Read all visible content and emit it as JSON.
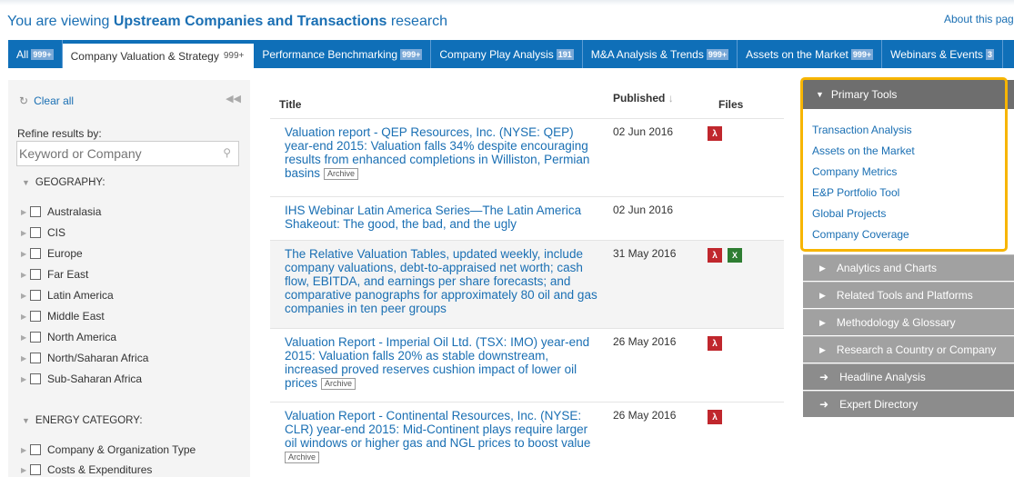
{
  "header": {
    "viewing_prefix": "You are viewing",
    "viewing_bold": "Upstream Companies and Transactions",
    "viewing_suffix": "research",
    "about_link": "About this page"
  },
  "tabs": [
    {
      "label": "All",
      "badge": "999+"
    },
    {
      "label": "Company Valuation & Strategy",
      "badge": "999+"
    },
    {
      "label": "Performance Benchmarking",
      "badge": "999+"
    },
    {
      "label": "Company Play Analysis",
      "badge": "191"
    },
    {
      "label": "M&A Analysis & Trends",
      "badge": "999+"
    },
    {
      "label": "Assets on the Market",
      "badge": "999+"
    },
    {
      "label": "Webinars & Events",
      "badge": "3"
    }
  ],
  "left_panel": {
    "clear_all": "Clear all",
    "refine_label": "Refine results by:",
    "search_placeholder": "Keyword or Company",
    "geography_heading": "GEOGRAPHY:",
    "geography": [
      "Australasia",
      "CIS",
      "Europe",
      "Far East",
      "Latin America",
      "Middle East",
      "North America",
      "North/Saharan Africa",
      "Sub-Saharan Africa"
    ],
    "energy_heading": "ENERGY CATEGORY:",
    "energy": [
      "Company & Organization Type",
      "Costs & Expenditures"
    ]
  },
  "results": {
    "col_title": "Title",
    "col_published": "Published",
    "col_files": "Files",
    "archive_label": "Archive",
    "rows": [
      {
        "title": "Valuation report - QEP Resources, Inc. (NYSE: QEP) year-end 2015: Valuation falls 34% despite encouraging results from enhanced completions in Williston, Permian basins",
        "date": "02 Jun 2016"
      },
      {
        "title": "IHS Webinar Latin America Series—The Latin America Shakeout: The good, the bad, and the ugly",
        "date": "02 Jun 2016"
      },
      {
        "title": "The Relative Valuation Tables, updated weekly, include company valuations, debt-to-appraised net worth; cash flow, EBITDA, and earnings per share forecasts; and comparative panographs for approximately 80 oil and gas companies in ten peer groups",
        "date": "31 May 2016"
      },
      {
        "title": "Valuation Report - Imperial Oil Ltd. (TSX: IMO) year-end 2015: Valuation falls 20% as stable downstream, increased proved reserves cushion impact of lower oil prices",
        "date": "26 May 2016"
      },
      {
        "title": "Valuation Report - Continental Resources, Inc. (NYSE: CLR) year-end 2015: Mid-Continent plays require larger oil windows or higher gas and NGL prices to boost value",
        "date": "26 May 2016"
      }
    ]
  },
  "right_panel": {
    "primary_heading": "Primary Tools",
    "primary_tools": [
      "Transaction Analysis",
      "Assets on the Market",
      "Company Metrics",
      "E&P Portfolio Tool",
      "Global Projects",
      "Company Coverage"
    ],
    "sections": [
      "Analytics and Charts",
      "Related Tools and Platforms",
      "Methodology & Glossary",
      "Research a Country or Company"
    ],
    "links": [
      "Headline Analysis",
      "Expert Directory"
    ]
  },
  "colors": {
    "tab_bar": "#0f6fb8",
    "link": "#1a6fb3",
    "highlight": "#f7b500",
    "pdf": "#c0272d",
    "xls": "#2e7d32"
  }
}
